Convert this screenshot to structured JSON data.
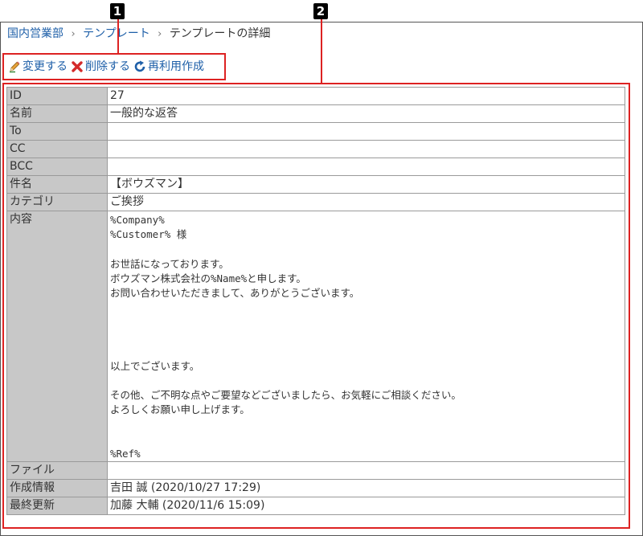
{
  "breadcrumb": {
    "items": [
      "国内営業部",
      "テンプレート"
    ],
    "separator": "›",
    "current": "テンプレートの詳細"
  },
  "actions": {
    "edit": "変更する",
    "delete": "削除する",
    "reuse": "再利用作成"
  },
  "callouts": [
    "1",
    "2"
  ],
  "detail": {
    "rows": [
      {
        "label": "ID",
        "value": "27"
      },
      {
        "label": "名前",
        "value": "一般的な返答"
      },
      {
        "label": "To",
        "value": ""
      },
      {
        "label": "CC",
        "value": ""
      },
      {
        "label": "BCC",
        "value": ""
      },
      {
        "label": "件名",
        "value": "【ボウズマン】"
      },
      {
        "label": "カテゴリ",
        "value": "ご挨拶"
      }
    ],
    "body_label": "内容",
    "body_lines": [
      "%Company%",
      "%Customer% 様",
      "",
      "お世話になっております。",
      "ボウズマン株式会社の%Name%と申します。",
      "お問い合わせいただきまして、ありがとうございます。",
      "",
      "",
      "",
      "",
      "以上でございます。",
      "",
      "その他、ご不明な点やご要望などございましたら、お気軽にご相談ください。",
      "よろしくお願い申し上げます。",
      "",
      "",
      "%Ref%"
    ],
    "file_label": "ファイル",
    "file_value": "",
    "created_label": "作成情報",
    "created_value": "吉田 誠 (2020/10/27 17:29)",
    "updated_label": "最終更新",
    "updated_value": "加藤 大輔 (2020/11/6 15:09)"
  },
  "colors": {
    "link": "#1e5fa8",
    "highlight": "#dd2222",
    "label_bg": "#c8c8c8"
  }
}
